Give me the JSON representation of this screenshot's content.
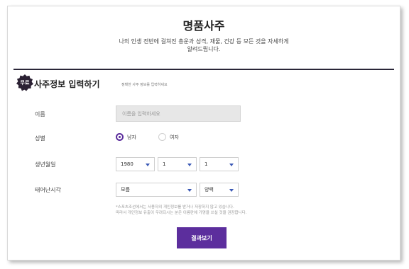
{
  "header": {
    "title": "명품사주",
    "description_line1": "나의 인생 전반에 걸쳐진 총운과 성격, 재물, 건강 등 모든 것을 자세하게",
    "description_line2": "알려드립니다."
  },
  "section": {
    "badge": "무료",
    "title": "사주정보 입력하기",
    "subtitle": "정확한 사주 정보를 입력하세요"
  },
  "form": {
    "name_label": "이름",
    "name_placeholder": "이름을 입력하세요",
    "gender_label": "성별",
    "gender_options": [
      {
        "label": "남자",
        "selected": true
      },
      {
        "label": "여자",
        "selected": false
      }
    ],
    "birth_label": "생년월일",
    "birth_year": "1980",
    "birth_month": "1",
    "birth_day": "1",
    "time_label": "태어난시각",
    "time_value": "모름",
    "calendar_value": "양력"
  },
  "notice": {
    "line1": "*스포츠조선에서는 사용자의 개인정보를 받거나 저장하지 않고 있습니다.",
    "line2": "따라서 개인정보 유출이 우려되시는 분은 이름란에 가명을 쓰실 것을 권장합니다."
  },
  "submit_label": "결과보기",
  "colors": {
    "accent": "#5c2e9d",
    "divider": "#2a2638",
    "badge": "#2b2133",
    "caret": "#3a58b5"
  }
}
